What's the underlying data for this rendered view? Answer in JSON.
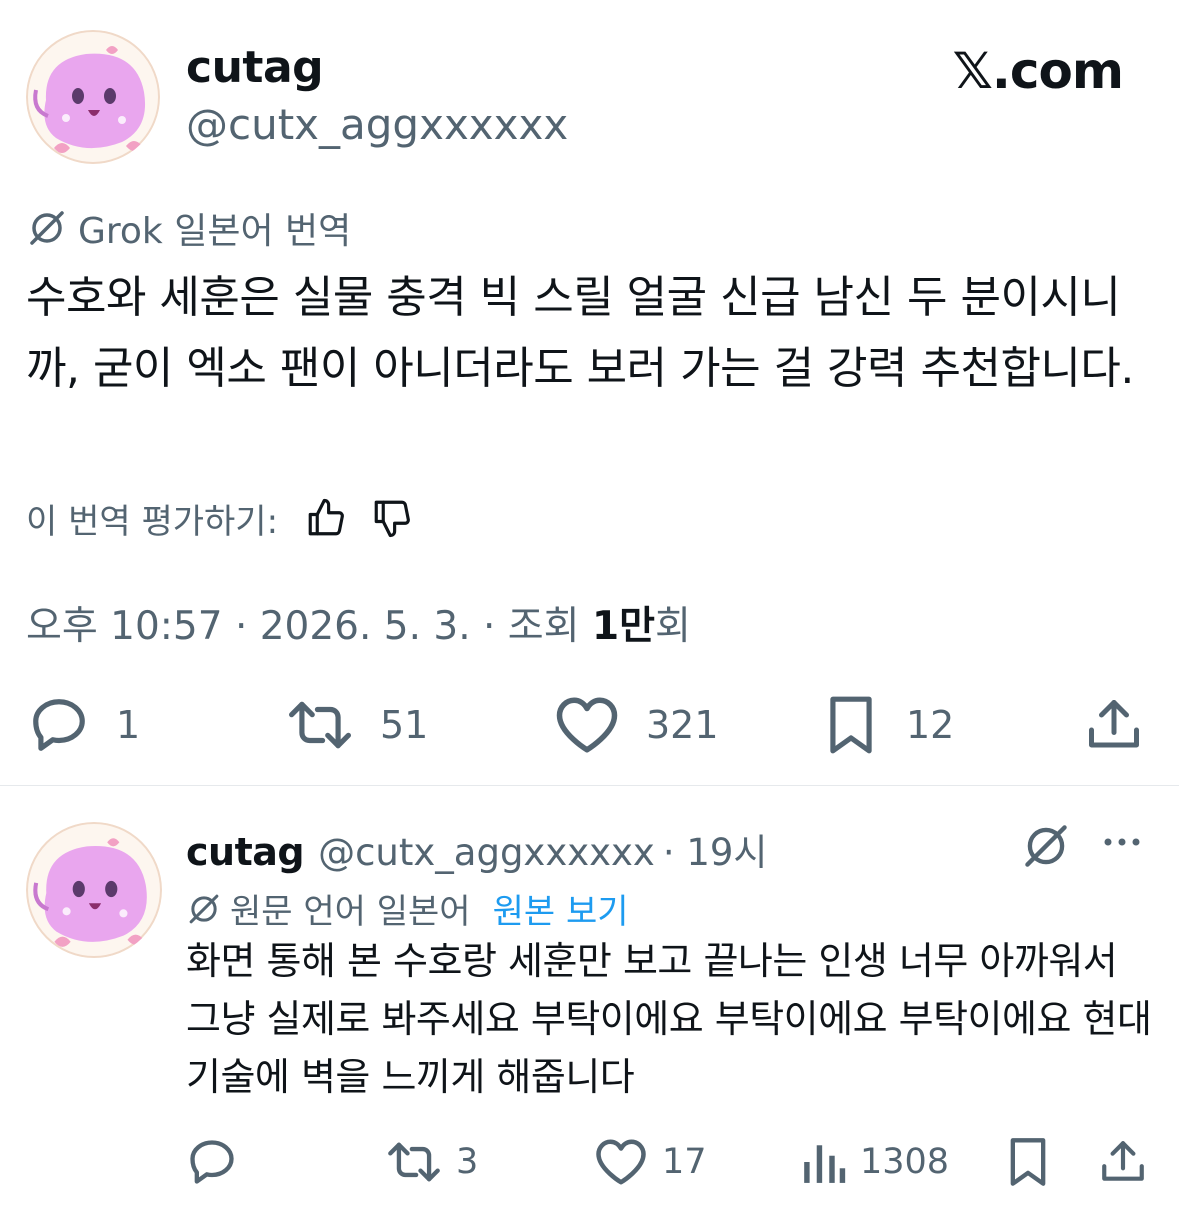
{
  "tweet": {
    "author": {
      "name": "cutag",
      "handle": "@cutx_aggxxxxxx"
    },
    "brand": "𝕏.com",
    "grok_label": "Grok 일본어 번역",
    "text": "수호와 세훈은 실물 충격 빅 스릴 얼굴 신급 남신 두 분이시니까, 굳이 엑소 팬이 아니더라도 보러 가는 걸 강력 추천합니다.",
    "rate_label": "이 번역 평가하기:",
    "meta": {
      "time_date": "오후 10:57 · 2026. 5. 3. · 조회 ",
      "views_bold": "1만",
      "views_suffix": "회"
    },
    "actions": {
      "replies": "1",
      "retweets": "51",
      "likes": "321",
      "bookmarks": "12"
    }
  },
  "reply": {
    "author": {
      "name": "cutag",
      "handle": "@cutx_aggxxxxxx",
      "time": "· 19시"
    },
    "lang_label": "원문 언어 일본어",
    "view_original": "원본 보기",
    "text": "화면 통해 본 수호랑 세훈만 보고 끝나는 인생 너무 아까워서 그냥 실제로 봐주세요 부탁이에요 부탁이에요 부탁이에요 현대 기술에 벽을 느끼게 해줍니다",
    "actions": {
      "retweets": "3",
      "likes": "17",
      "views": "1308"
    }
  },
  "colors": {
    "text": "#0f1419",
    "secondary": "#536471",
    "link": "#1d9bf0",
    "avatar_pink": "#e9a6ee"
  }
}
